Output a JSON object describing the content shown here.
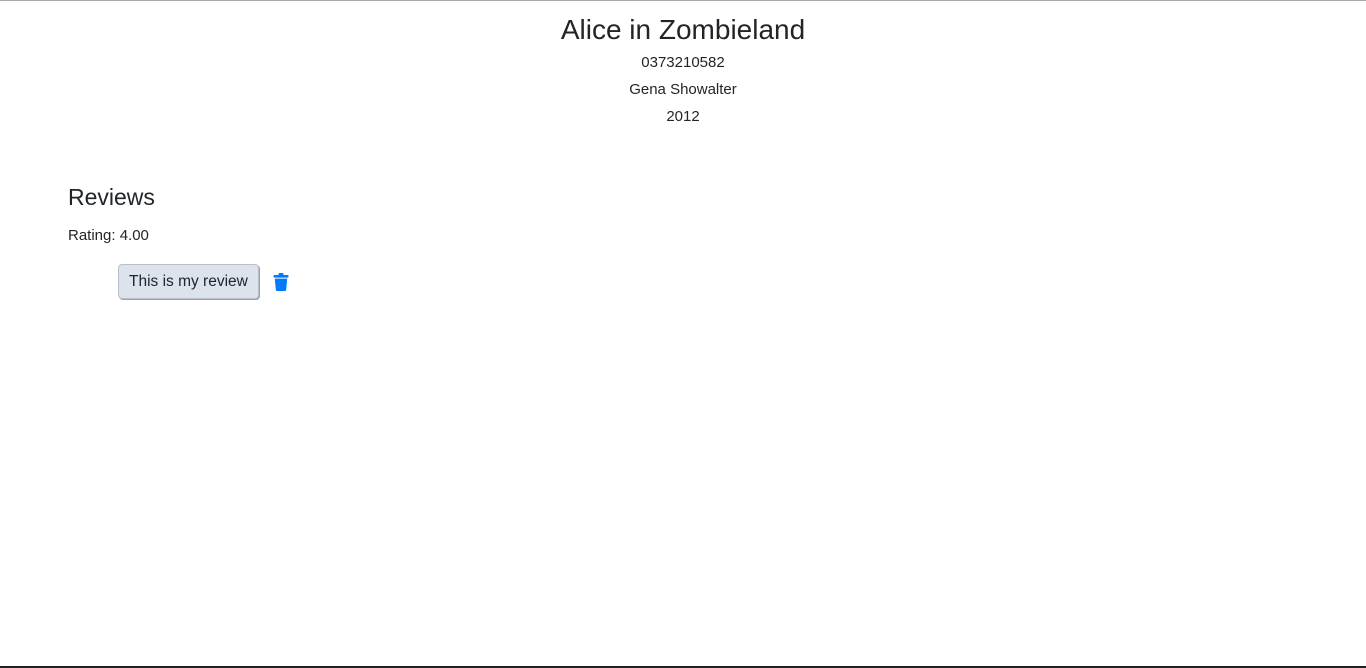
{
  "book": {
    "title": "Alice in Zombieland",
    "isbn": "0373210582",
    "author": "Gena Showalter",
    "year": "2012"
  },
  "reviews": {
    "heading": "Reviews",
    "rating_text": "Rating: 4.00",
    "items": [
      {
        "text": "This is my review",
        "delete_icon": "trash-icon"
      }
    ]
  },
  "colors": {
    "accent": "#007bff",
    "review_button_bg": "#dde3ec",
    "text": "#212529"
  }
}
